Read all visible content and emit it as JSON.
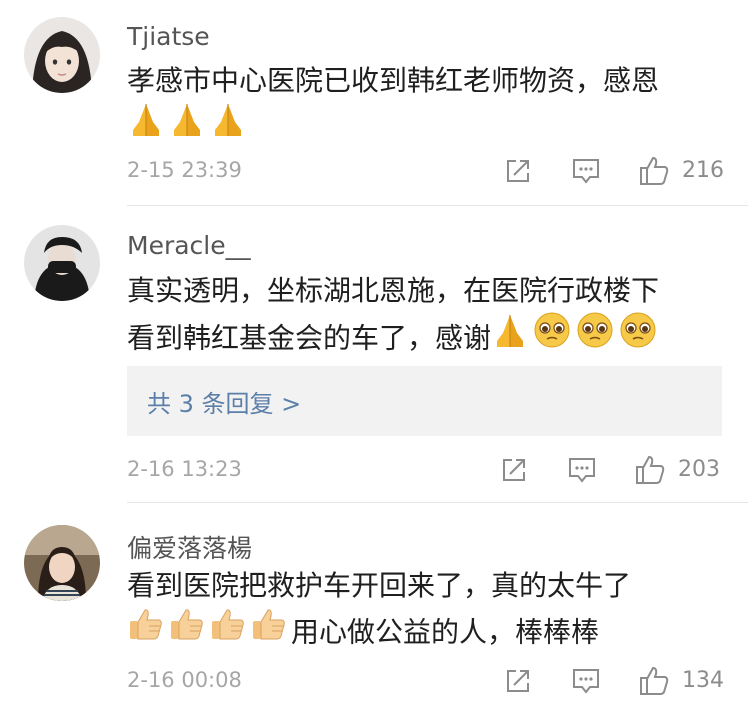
{
  "comments": [
    {
      "username": "Tjiatse",
      "line1": "孝感市中心医院已收到韩红老师物资，感恩",
      "emoji_line": [
        "folded-hands",
        "folded-hands",
        "folded-hands"
      ],
      "time": "2-15 23:39",
      "likes": "216"
    },
    {
      "username": "Meracle__",
      "line1": "真实透明，坐标湖北恩施，在医院行政楼下",
      "line2": "看到韩红基金会的车了，感谢",
      "line2_emojis": [
        "folded-hands",
        "pleading-face",
        "pleading-face",
        "pleading-face"
      ],
      "replies_label": "共 3 条回复 >",
      "time": "2-16 13:23",
      "likes": "203"
    },
    {
      "username": "偏爱落落楊",
      "line1": "看到医院把救护车开回来了，真的太牛了",
      "line2_emojis": [
        "thumbs-up",
        "thumbs-up",
        "thumbs-up",
        "thumbs-up"
      ],
      "line2_text": "用心做公益的人，棒棒棒",
      "time": "2-16 00:08",
      "likes": "134"
    }
  ],
  "icons": {
    "share": "share-icon",
    "comment": "comment-icon",
    "like": "thumbs-up-icon"
  },
  "colors": {
    "name": "#555555",
    "time": "#a6a6a6",
    "link": "#5b7fa8",
    "reply_bg": "#f2f2f2",
    "emoji": "#f5b82e"
  }
}
